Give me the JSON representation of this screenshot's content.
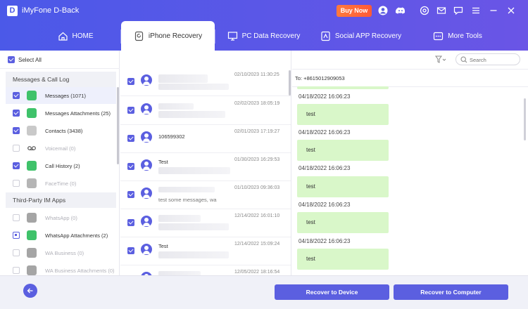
{
  "app": {
    "title": "iMyFone D-Back",
    "logo_letter": "D",
    "buy_now": "Buy Now"
  },
  "nav": {
    "tabs": [
      {
        "label": "HOME",
        "icon": "home-icon"
      },
      {
        "label": "iPhone Recovery",
        "icon": "phone-recovery-icon"
      },
      {
        "label": "PC Data Recovery",
        "icon": "pc-icon"
      },
      {
        "label": "Social APP Recovery",
        "icon": "social-app-icon"
      },
      {
        "label": "More Tools",
        "icon": "more-tools-icon"
      }
    ],
    "active_index": 1
  },
  "left": {
    "select_all": "Select All",
    "sections": [
      {
        "title": "Messages & Call Log"
      },
      {
        "title": "Third-Party IM Apps"
      }
    ],
    "items": [
      {
        "label": "Messages (1071)",
        "state": "checked",
        "icon_color": "#3fc26a",
        "dim": false
      },
      {
        "label": "Messages Attachments (25)",
        "state": "checked",
        "icon_color": "#3fc26a",
        "dim": false
      },
      {
        "label": "Contacts (3438)",
        "state": "checked",
        "icon_color": "#b9b9b9",
        "dim": false
      },
      {
        "label": "Voicemail (0)",
        "state": "unchecked",
        "icon_color": "#555555",
        "dim": true
      },
      {
        "label": "Call History (2)",
        "state": "checked",
        "icon_color": "#3fc26a",
        "dim": false
      },
      {
        "label": "FaceTime (0)",
        "state": "unchecked",
        "icon_color": "#b0b0b0",
        "dim": true
      },
      {
        "label": "WhatsApp (0)",
        "state": "unchecked",
        "icon_color": "#9a9a9a",
        "dim": true
      },
      {
        "label": "WhatsApp Attachments (2)",
        "state": "partial",
        "icon_color": "#3fc26a",
        "dim": false
      },
      {
        "label": "WA Business (0)",
        "state": "unchecked",
        "icon_color": "#9a9a9a",
        "dim": true
      },
      {
        "label": "WA Business Attachments (0)",
        "state": "unchecked",
        "icon_color": "#9a9a9a",
        "dim": true
      }
    ]
  },
  "messages": [
    {
      "name": "",
      "date": "02/10/2023 11:30:25",
      "preview": ""
    },
    {
      "name": "",
      "date": "02/02/2023 18:05:19",
      "preview": ""
    },
    {
      "name": "106599302",
      "date": "02/01/2023 17:19:27",
      "preview": ""
    },
    {
      "name": "Test",
      "date": "01/30/2023 16:29:53",
      "preview": ""
    },
    {
      "name": "",
      "date": "01/10/2023 09:36:03",
      "preview": "test some messages, wa"
    },
    {
      "name": "",
      "date": "12/14/2022 16:01:10",
      "preview": ""
    },
    {
      "name": "Test",
      "date": "12/14/2022 15:09:24",
      "preview": ""
    },
    {
      "name": "",
      "date": "12/05/2022 18:16:54",
      "preview": ""
    }
  ],
  "chat": {
    "to": "To:  +8615012909053",
    "search_placeholder": "Search",
    "entries": [
      {
        "timestamp": "04/18/2022 16:06:23",
        "text": "test"
      },
      {
        "timestamp": "04/18/2022 16:06:23",
        "text": "test"
      },
      {
        "timestamp": "04/18/2022 16:06:23",
        "text": "test"
      },
      {
        "timestamp": "04/18/2022 16:06:23",
        "text": "test"
      },
      {
        "timestamp": "04/18/2022 16:06:23",
        "text": "test"
      }
    ],
    "bubble_color": "#d9f7c9"
  },
  "actions": {
    "recover_device": "Recover to Device",
    "recover_computer": "Recover to Computer"
  },
  "colors": {
    "accent": "#5b5fe0",
    "header_start": "#4b59e8",
    "header_end": "#6a55e6",
    "buy_now": "#ff6a3a"
  }
}
